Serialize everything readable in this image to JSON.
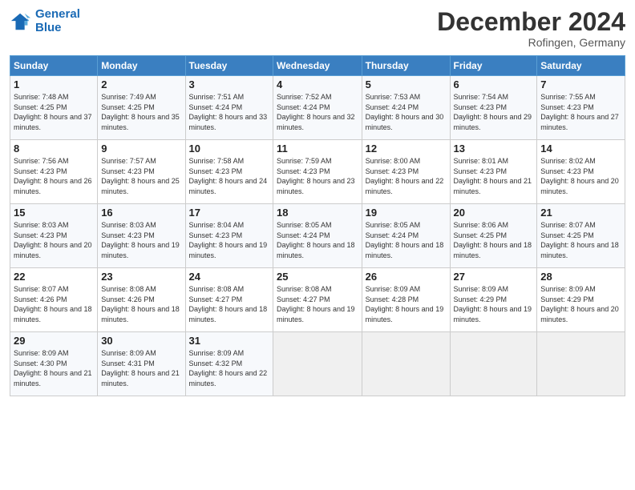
{
  "header": {
    "logo_line1": "General",
    "logo_line2": "Blue",
    "month": "December 2024",
    "location": "Rofingen, Germany"
  },
  "days_of_week": [
    "Sunday",
    "Monday",
    "Tuesday",
    "Wednesday",
    "Thursday",
    "Friday",
    "Saturday"
  ],
  "weeks": [
    [
      {
        "day": "1",
        "info": "Sunrise: 7:48 AM\nSunset: 4:25 PM\nDaylight: 8 hours and 37 minutes."
      },
      {
        "day": "2",
        "info": "Sunrise: 7:49 AM\nSunset: 4:25 PM\nDaylight: 8 hours and 35 minutes."
      },
      {
        "day": "3",
        "info": "Sunrise: 7:51 AM\nSunset: 4:24 PM\nDaylight: 8 hours and 33 minutes."
      },
      {
        "day": "4",
        "info": "Sunrise: 7:52 AM\nSunset: 4:24 PM\nDaylight: 8 hours and 32 minutes."
      },
      {
        "day": "5",
        "info": "Sunrise: 7:53 AM\nSunset: 4:24 PM\nDaylight: 8 hours and 30 minutes."
      },
      {
        "day": "6",
        "info": "Sunrise: 7:54 AM\nSunset: 4:23 PM\nDaylight: 8 hours and 29 minutes."
      },
      {
        "day": "7",
        "info": "Sunrise: 7:55 AM\nSunset: 4:23 PM\nDaylight: 8 hours and 27 minutes."
      }
    ],
    [
      {
        "day": "8",
        "info": "Sunrise: 7:56 AM\nSunset: 4:23 PM\nDaylight: 8 hours and 26 minutes."
      },
      {
        "day": "9",
        "info": "Sunrise: 7:57 AM\nSunset: 4:23 PM\nDaylight: 8 hours and 25 minutes."
      },
      {
        "day": "10",
        "info": "Sunrise: 7:58 AM\nSunset: 4:23 PM\nDaylight: 8 hours and 24 minutes."
      },
      {
        "day": "11",
        "info": "Sunrise: 7:59 AM\nSunset: 4:23 PM\nDaylight: 8 hours and 23 minutes."
      },
      {
        "day": "12",
        "info": "Sunrise: 8:00 AM\nSunset: 4:23 PM\nDaylight: 8 hours and 22 minutes."
      },
      {
        "day": "13",
        "info": "Sunrise: 8:01 AM\nSunset: 4:23 PM\nDaylight: 8 hours and 21 minutes."
      },
      {
        "day": "14",
        "info": "Sunrise: 8:02 AM\nSunset: 4:23 PM\nDaylight: 8 hours and 20 minutes."
      }
    ],
    [
      {
        "day": "15",
        "info": "Sunrise: 8:03 AM\nSunset: 4:23 PM\nDaylight: 8 hours and 20 minutes."
      },
      {
        "day": "16",
        "info": "Sunrise: 8:03 AM\nSunset: 4:23 PM\nDaylight: 8 hours and 19 minutes."
      },
      {
        "day": "17",
        "info": "Sunrise: 8:04 AM\nSunset: 4:23 PM\nDaylight: 8 hours and 19 minutes."
      },
      {
        "day": "18",
        "info": "Sunrise: 8:05 AM\nSunset: 4:24 PM\nDaylight: 8 hours and 18 minutes."
      },
      {
        "day": "19",
        "info": "Sunrise: 8:05 AM\nSunset: 4:24 PM\nDaylight: 8 hours and 18 minutes."
      },
      {
        "day": "20",
        "info": "Sunrise: 8:06 AM\nSunset: 4:25 PM\nDaylight: 8 hours and 18 minutes."
      },
      {
        "day": "21",
        "info": "Sunrise: 8:07 AM\nSunset: 4:25 PM\nDaylight: 8 hours and 18 minutes."
      }
    ],
    [
      {
        "day": "22",
        "info": "Sunrise: 8:07 AM\nSunset: 4:26 PM\nDaylight: 8 hours and 18 minutes."
      },
      {
        "day": "23",
        "info": "Sunrise: 8:08 AM\nSunset: 4:26 PM\nDaylight: 8 hours and 18 minutes."
      },
      {
        "day": "24",
        "info": "Sunrise: 8:08 AM\nSunset: 4:27 PM\nDaylight: 8 hours and 18 minutes."
      },
      {
        "day": "25",
        "info": "Sunrise: 8:08 AM\nSunset: 4:27 PM\nDaylight: 8 hours and 19 minutes."
      },
      {
        "day": "26",
        "info": "Sunrise: 8:09 AM\nSunset: 4:28 PM\nDaylight: 8 hours and 19 minutes."
      },
      {
        "day": "27",
        "info": "Sunrise: 8:09 AM\nSunset: 4:29 PM\nDaylight: 8 hours and 19 minutes."
      },
      {
        "day": "28",
        "info": "Sunrise: 8:09 AM\nSunset: 4:29 PM\nDaylight: 8 hours and 20 minutes."
      }
    ],
    [
      {
        "day": "29",
        "info": "Sunrise: 8:09 AM\nSunset: 4:30 PM\nDaylight: 8 hours and 21 minutes."
      },
      {
        "day": "30",
        "info": "Sunrise: 8:09 AM\nSunset: 4:31 PM\nDaylight: 8 hours and 21 minutes."
      },
      {
        "day": "31",
        "info": "Sunrise: 8:09 AM\nSunset: 4:32 PM\nDaylight: 8 hours and 22 minutes."
      },
      {
        "day": "",
        "info": ""
      },
      {
        "day": "",
        "info": ""
      },
      {
        "day": "",
        "info": ""
      },
      {
        "day": "",
        "info": ""
      }
    ]
  ]
}
